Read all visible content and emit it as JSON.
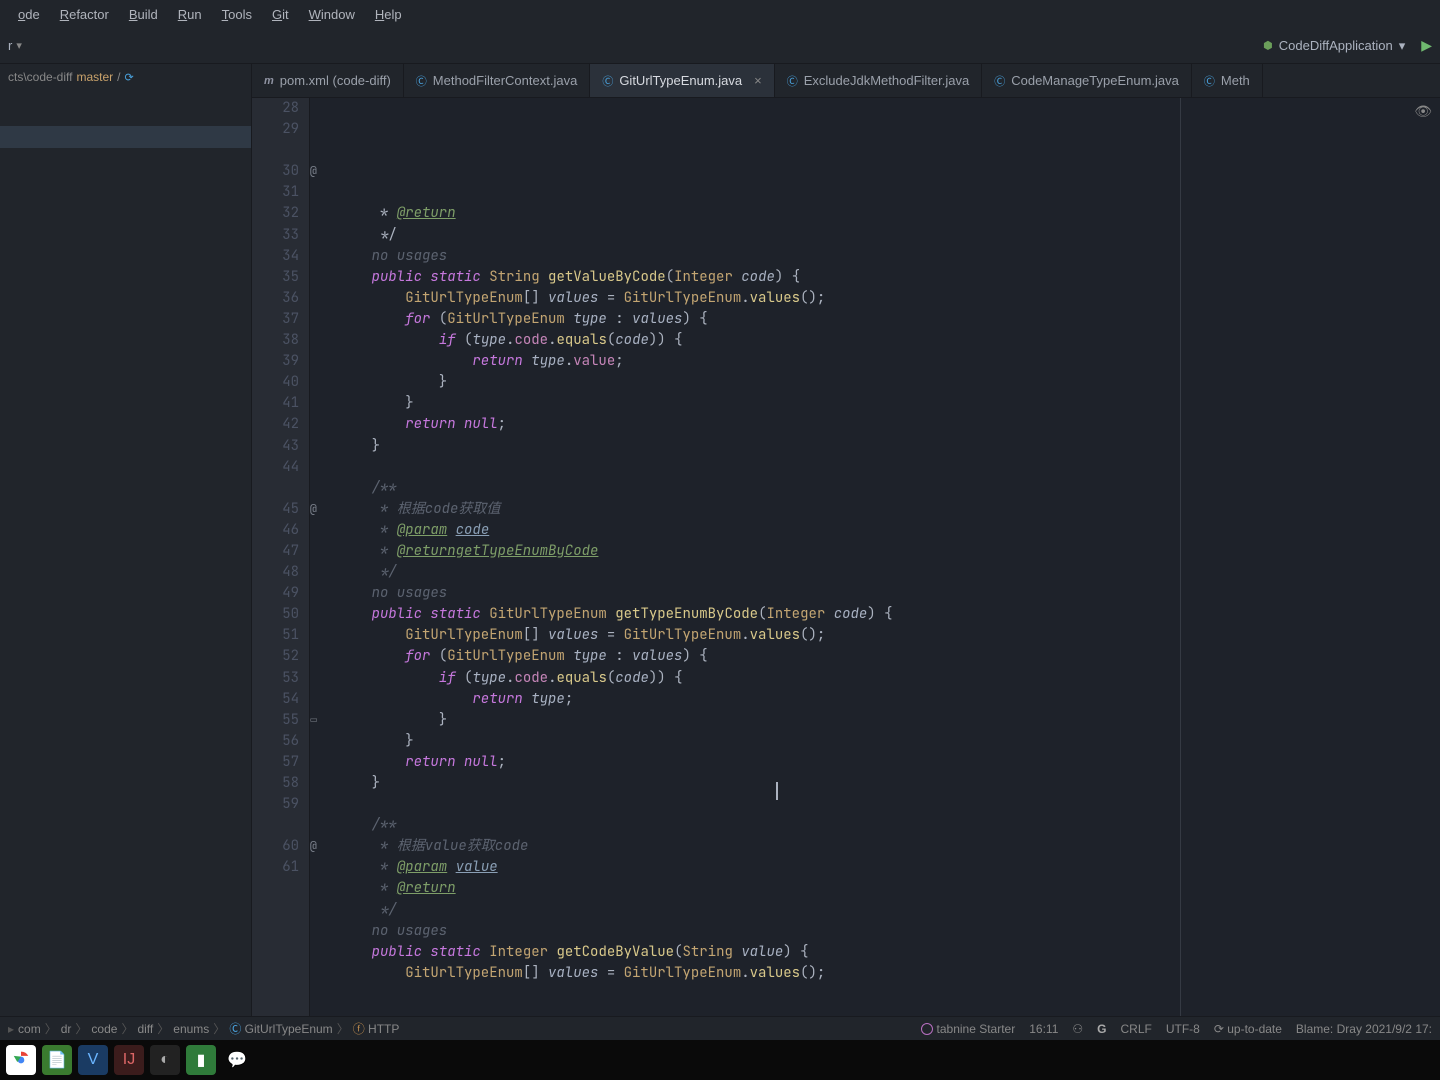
{
  "menu": [
    "ode",
    "Refactor",
    "Build",
    "Run",
    "Tools",
    "Git",
    "Window",
    "Help"
  ],
  "runConfig": "CodeDiffApplication",
  "navPath": "cts\\code-diff",
  "branch": "master",
  "tabs": [
    {
      "icon": "m",
      "label": "pom.xml (code-diff)",
      "active": false
    },
    {
      "icon": "c",
      "label": "MethodFilterContext.java",
      "active": false
    },
    {
      "icon": "c",
      "label": "GitUrlTypeEnum.java",
      "active": true,
      "close": true
    },
    {
      "icon": "c",
      "label": "ExcludeJdkMethodFilter.java",
      "active": false
    },
    {
      "icon": "c",
      "label": "CodeManageTypeEnum.java",
      "active": false
    },
    {
      "icon": "c",
      "label": "Meth",
      "active": false
    }
  ],
  "linesStart": 28,
  "code": [
    {
      "n": 28,
      "html": "     * <span class='doctag'>@return</span>"
    },
    {
      "n": 29,
      "html": "     */"
    },
    {
      "n": "",
      "html": "    <span class='hint'>no usages</span>"
    },
    {
      "n": 30,
      "ann": "@",
      "html": "    <span class='kw'>public</span> <span class='kw'>static</span> <span class='type'>String</span> <span class='method'>getValueByCode</span>(<span class='type'>Integer</span> <span class='param'>code</span>) {"
    },
    {
      "n": 31,
      "html": "        <span class='type'>GitUrlTypeEnum</span>[] <span class='param'>values</span> = <span class='type'>GitUrlTypeEnum</span>.<span class='method'>values</span>();"
    },
    {
      "n": 32,
      "html": "        <span class='kw'>for</span> (<span class='type'>GitUrlTypeEnum</span> <span class='param'>type</span> : <span class='param'>values</span>) {"
    },
    {
      "n": 33,
      "html": "            <span class='kw'>if</span> (<span class='param'>type</span>.<span class='field'>code</span>.<span class='method'>equals</span>(<span class='param'>code</span>)) {"
    },
    {
      "n": 34,
      "html": "                <span class='kw'>return</span> <span class='param'>type</span>.<span class='field'>value</span>;"
    },
    {
      "n": 35,
      "html": "            }"
    },
    {
      "n": 36,
      "html": "        }"
    },
    {
      "n": 37,
      "html": "        <span class='kw'>return</span> <span class='kw'>null</span>;"
    },
    {
      "n": 38,
      "html": "    }"
    },
    {
      "n": 39,
      "html": ""
    },
    {
      "n": 40,
      "html": "    <span class='cmt'>/**</span>"
    },
    {
      "n": 41,
      "html": "     <span class='cmt'>* 根据code获取值</span>"
    },
    {
      "n": 42,
      "html": "     <span class='cmt'>*</span> <span class='doctag'>@param</span> <span class='doclink'>code</span>"
    },
    {
      "n": 43,
      "html": "     <span class='cmt'>*</span> <span class='doctag'>@returngetTypeEnumByCode</span>"
    },
    {
      "n": 44,
      "html": "     <span class='cmt'>*/</span>"
    },
    {
      "n": "",
      "html": "    <span class='hint'>no usages</span>"
    },
    {
      "n": 45,
      "ann": "@",
      "html": "    <span class='kw'>public</span> <span class='kw'>static</span> <span class='type'>GitUrlTypeEnum</span> <span class='method'>getTypeEnumByCode</span>(<span class='type'>Integer</span> <span class='param'>code</span>) {"
    },
    {
      "n": 46,
      "html": "        <span class='type'>GitUrlTypeEnum</span>[] <span class='param'>values</span> = <span class='type'>GitUrlTypeEnum</span>.<span class='method'>values</span>();"
    },
    {
      "n": 47,
      "html": "        <span class='kw'>for</span> (<span class='type'>GitUrlTypeEnum</span> <span class='param'>type</span> : <span class='param'>values</span>) {"
    },
    {
      "n": 48,
      "html": "            <span class='kw'>if</span> (<span class='param'>type</span>.<span class='field'>code</span>.<span class='method'>equals</span>(<span class='param'>code</span>)) {"
    },
    {
      "n": 49,
      "html": "                <span class='kw'>return</span> <span class='param'>type</span>;"
    },
    {
      "n": 50,
      "html": "            }"
    },
    {
      "n": 51,
      "html": "        }"
    },
    {
      "n": 52,
      "html": "        <span class='kw'>return</span> <span class='kw'>null</span>;"
    },
    {
      "n": 53,
      "html": "    }"
    },
    {
      "n": 54,
      "html": ""
    },
    {
      "n": 55,
      "bkmk": true,
      "html": "    <span class='cmt'>/**</span>"
    },
    {
      "n": 56,
      "html": "     <span class='cmt'>* 根据value获取code</span>"
    },
    {
      "n": 57,
      "html": "     <span class='cmt'>*</span> <span class='doctag'>@param</span> <span class='doclink'>value</span>"
    },
    {
      "n": 58,
      "html": "     <span class='cmt'>*</span> <span class='doctag'>@return</span>"
    },
    {
      "n": 59,
      "html": "     <span class='cmt'>*/</span>"
    },
    {
      "n": "",
      "html": "    <span class='hint'>no usages</span>"
    },
    {
      "n": 60,
      "ann": "@",
      "html": "    <span class='kw'>public</span> <span class='kw'>static</span> <span class='type'>Integer</span> <span class='method'>getCodeByValue</span>(<span class='type'>String</span> <span class='param'>value</span>) {"
    },
    {
      "n": 61,
      "html": "        <span class='type'>GitUrlTypeEnum</span>[] <span class='param'>values</span> = <span class='type'>GitUrlTypeEnum</span>.<span class='method'>values</span>();"
    }
  ],
  "breadcrumb": [
    "com",
    "dr",
    "code",
    "diff",
    "enums",
    "GitUrlTypeEnum",
    "HTTP"
  ],
  "breadcrumbIcons": {
    "5": "c",
    "6": "f"
  },
  "status": {
    "tabnine": "tabnine Starter",
    "cursor": "16:11",
    "le": "CRLF",
    "enc": "UTF-8",
    "git": "up-to-date",
    "blame": "Blame: Dray 2021/9/2 17:"
  },
  "taskbar": [
    {
      "bg": "#fff",
      "fg": "",
      "txt": "",
      "svg": "chrome"
    },
    {
      "bg": "#3a7b2f",
      "fg": "#fff",
      "txt": "📄"
    },
    {
      "bg": "#1a3b63",
      "fg": "#6bb5ff",
      "txt": "V"
    },
    {
      "bg": "#3b1c1c",
      "fg": "#d66",
      "txt": "IJ"
    },
    {
      "bg": "#222",
      "fg": "#aaa",
      "txt": "◐"
    },
    {
      "bg": "#2f7b3a",
      "fg": "#fff",
      "txt": "▮"
    },
    {
      "bg": "transparent",
      "fg": "#6bca6b",
      "txt": "💬"
    }
  ]
}
